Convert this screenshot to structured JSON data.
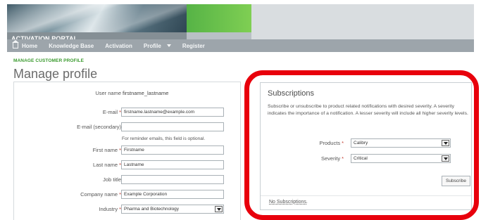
{
  "header": {
    "portal_title": "ACTIVATION PORTAL"
  },
  "nav": {
    "items": [
      "Home",
      "Knowledge Base",
      "Activation",
      "Profile",
      "Register"
    ]
  },
  "page": {
    "breadcrumb": "MANAGE CUSTOMER PROFILE",
    "title": "Manage profile"
  },
  "form": {
    "username_label": "User name",
    "username_value": "firstname_lastname",
    "email_label": "E-mail",
    "email_value": "firstname.lastname@example.com",
    "email2_label": "E-mail (secondary)",
    "email2_value": "",
    "email2_hint": "For reminder emails, this field is optional.",
    "firstname_label": "First name",
    "firstname_value": "Firstname",
    "lastname_label": "Last name",
    "lastname_value": "Lastname",
    "jobtitle_label": "Job title",
    "jobtitle_value": "",
    "company_label": "Company name",
    "company_value": "Example Corporation",
    "industry_label": "Industry",
    "industry_value": "Pharma and Biotechnology",
    "required_mark": "*"
  },
  "subscriptions": {
    "title": "Subscriptions",
    "description": "Subscribe or unsubscribe to product related notifications with desired severity. A severity indicates the importance of a notification. A lesser severity will include all higher severity levels.",
    "products_label": "Products",
    "products_value": "Calibry",
    "severity_label": "Severity",
    "severity_value": "Critical",
    "subscribe_label": "Subscribe",
    "empty_text": "No Subscriptions."
  },
  "colors": {
    "accent_green": "#3a9a2e",
    "highlight_red": "#e8000c",
    "nav_gray": "#9da5ab"
  },
  "icons": {
    "home": "home-icon",
    "dropdown": "chevron-down-icon"
  }
}
